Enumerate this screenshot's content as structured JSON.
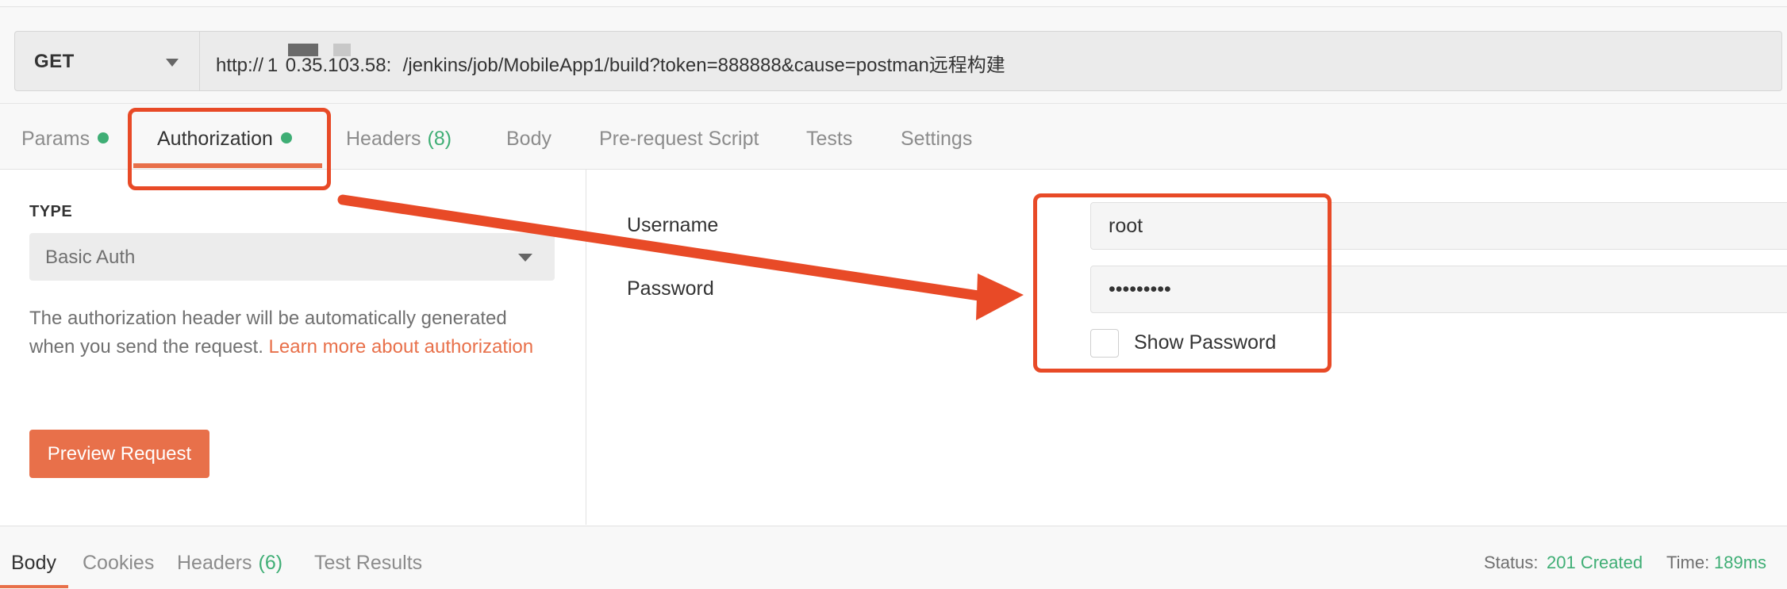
{
  "request": {
    "method": "GET",
    "url": "http:// 1  0.35.103.58:   /jenkins/job/MobileApp1/build?token=888888&cause=postman远程构建"
  },
  "tabs": [
    {
      "label": "Params",
      "dot": true
    },
    {
      "label": "Authorization",
      "dot": true
    },
    {
      "label": "Headers",
      "count": "(8)"
    },
    {
      "label": "Body"
    },
    {
      "label": "Pre-request Script"
    },
    {
      "label": "Tests"
    },
    {
      "label": "Settings"
    }
  ],
  "auth": {
    "type_label": "TYPE",
    "type_value": "Basic Auth",
    "description": "The authorization header will be automatically generated when you send the request. ",
    "learn_more": "Learn more about authorization",
    "preview_button": "Preview Request",
    "username_label": "Username",
    "username_value": "root",
    "password_label": "Password",
    "password_value": "•••••••••",
    "show_password_label": "Show Password"
  },
  "response": {
    "tabs": [
      {
        "label": "Body"
      },
      {
        "label": "Cookies"
      },
      {
        "label": "Headers",
        "count": "(6)"
      },
      {
        "label": "Test Results"
      }
    ],
    "status_label": "Status:",
    "status_value": "201 Created",
    "time_label": "Time:",
    "time_value": "189ms"
  },
  "colors": {
    "accent": "#e8704a",
    "annotation": "#e84a27",
    "success": "#3fae75"
  }
}
